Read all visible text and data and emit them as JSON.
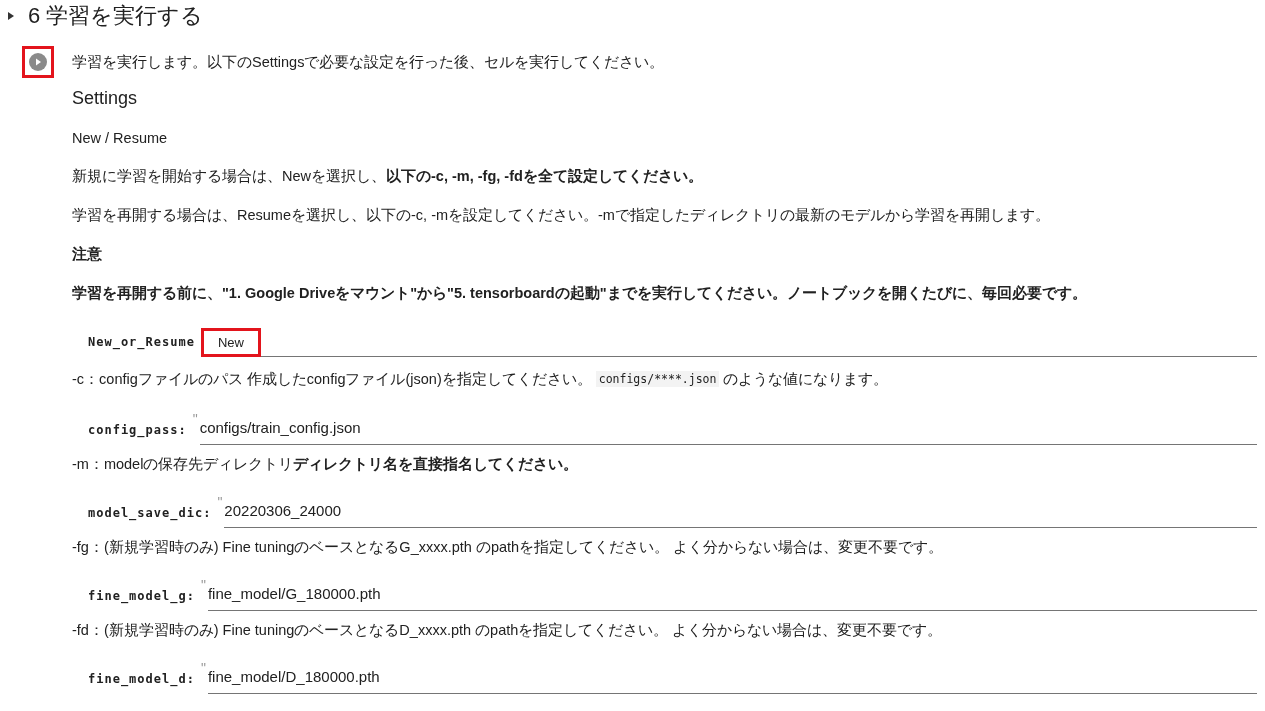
{
  "section": {
    "title": "6 学習を実行する"
  },
  "run_button": {
    "highlighted": true
  },
  "description": "学習を実行します。以下のSettingsで必要な設定を行った後、セルを実行してください。",
  "cells": [
    {
      "kind": "heading",
      "text": "Settings"
    },
    {
      "kind": "text",
      "text": "New / Resume",
      "bold": false
    },
    {
      "kind": "text",
      "text": "新規に学習を開始する場合は、Newを選択し、**以下の-c, -m, -fg, -fdを全て設定してください。**",
      "bold": false
    },
    {
      "kind": "text",
      "text": "学習を再開する場合は、Resumeを選択し、以下の-c, -mを設定してください。-mで指定したディレクトリの最新のモデルから学習を再開します。",
      "bold": false
    },
    {
      "kind": "text",
      "text": "注意",
      "bold": true
    },
    {
      "kind": "text",
      "text": "学習を再開する前に、\"1. Google Driveをマウント\"から\"5. tensorboardの起動\"までを実行してください。ノートブックを開くたびに、毎回必要です。",
      "bold": true
    },
    {
      "kind": "dropdown",
      "label": "New_or_Resume",
      "value": "New",
      "highlighted": true
    },
    {
      "kind": "mixed",
      "parts": [
        {
          "kind": "text",
          "text": "-c：configファイルのパス 作成したconfigファイル(json)を指定してください。"
        },
        {
          "kind": "code",
          "text": "configs/****.json"
        },
        {
          "kind": "text",
          "text": "のような値になります。"
        }
      ]
    },
    {
      "kind": "input",
      "label": "config_pass:",
      "quote": "\"",
      "value": "configs/train_config.json"
    },
    {
      "kind": "text",
      "text": "-m：modelの保存先ディレクトリ **ディレクトリ名を直接指名してください。**",
      "bold": false
    },
    {
      "kind": "input",
      "label": "model_save_dic:",
      "quote": "\"",
      "value": "20220306_24000"
    },
    {
      "kind": "text",
      "text": "-fg：(新規学習時のみ) Fine tuningのベースとなるG_xxxx.pth のpathを指定してください。 よく分からない場合は、変更不要です。",
      "bold": false
    },
    {
      "kind": "input",
      "label": "fine_model_g:",
      "quote": "\"",
      "value": "fine_model/G_180000.pth"
    },
    {
      "kind": "text",
      "text": "-fd：(新規学習時のみ) Fine tuningのベースとなるD_xxxx.pth のpathを指定してください。 よく分からない場合は、変更不要です。",
      "bold": false
    },
    {
      "kind": "input",
      "label": "fine_model_d:",
      "quote": "\"",
      "value": "fine_model/D_180000.pth"
    }
  ]
}
